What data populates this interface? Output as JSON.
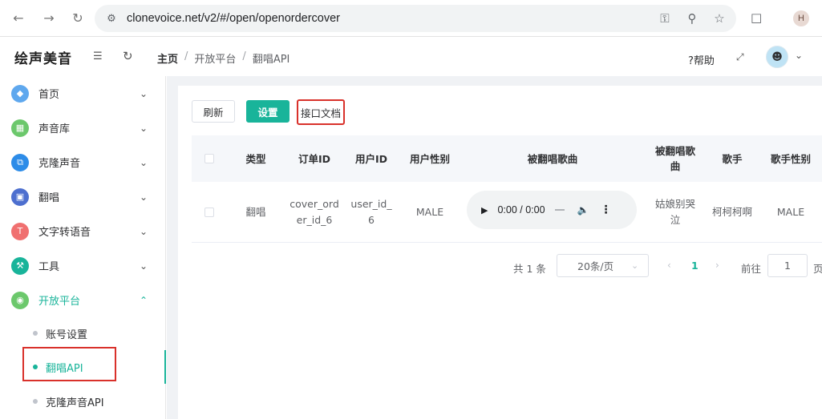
{
  "browser": {
    "url": "clonevoice.net/v2/#/open/openordercover",
    "profile_initial": "H"
  },
  "header": {
    "logo": "绘声美音",
    "breadcrumb": [
      "主页",
      "开放平台",
      "翻唱API"
    ],
    "help": "帮助"
  },
  "sidebar": {
    "items": [
      {
        "label": "首页",
        "icon_color": "#5fa8ee",
        "icon": "diamond-icon"
      },
      {
        "label": "声音库",
        "icon_color": "#6cc86c",
        "icon": "grid-icon"
      },
      {
        "label": "克隆声音",
        "icon_color": "#2d8ce8",
        "icon": "copy-icon"
      },
      {
        "label": "翻唱",
        "icon_color": "#4d6fcf",
        "icon": "twitter-icon"
      },
      {
        "label": "文字转语音",
        "icon_color": "#f07070",
        "icon": "text-icon"
      },
      {
        "label": "工具",
        "icon_color": "#19b49a",
        "icon": "wrench-icon"
      },
      {
        "label": "开放平台",
        "icon_color": "#6cc86c",
        "icon": "target-icon"
      }
    ],
    "sub_items": [
      {
        "label": "账号设置"
      },
      {
        "label": "翻唱API"
      },
      {
        "label": "克隆声音API"
      }
    ]
  },
  "toolbar": {
    "refresh": "刷新",
    "settings": "设置",
    "api_docs": "接口文档"
  },
  "table": {
    "columns": [
      "类型",
      "订单ID",
      "用户ID",
      "用户性别",
      "被翻唱歌曲",
      "被翻唱歌曲",
      "歌手",
      "歌手性别"
    ],
    "rows": [
      {
        "type": "翻唱",
        "order_id": "cover_order_id_6",
        "user_id": "user_id_6",
        "user_gender": "MALE",
        "audio_time": "0:00 / 0:00",
        "song": "姑娘别哭泣",
        "singer": "柯柯柯啊",
        "singer_gender": "MALE"
      }
    ]
  },
  "pagination": {
    "total": "共 1 条",
    "page_size": "20条/页",
    "current_page": "1",
    "goto_label": "前往",
    "goto_value": "1",
    "page_suffix": "页"
  },
  "colors": {
    "accent": "#19b49a",
    "highlight_box": "#d9312b"
  }
}
